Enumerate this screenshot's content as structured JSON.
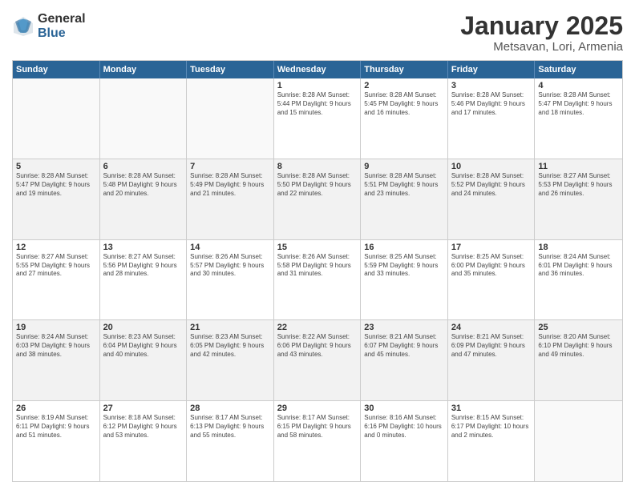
{
  "logo": {
    "general": "General",
    "blue": "Blue"
  },
  "title": {
    "month_year": "January 2025",
    "location": "Metsavan, Lori, Armenia"
  },
  "weekdays": [
    "Sunday",
    "Monday",
    "Tuesday",
    "Wednesday",
    "Thursday",
    "Friday",
    "Saturday"
  ],
  "rows": [
    [
      {
        "num": "",
        "info": ""
      },
      {
        "num": "",
        "info": ""
      },
      {
        "num": "",
        "info": ""
      },
      {
        "num": "1",
        "info": "Sunrise: 8:28 AM\nSunset: 5:44 PM\nDaylight: 9 hours\nand 15 minutes."
      },
      {
        "num": "2",
        "info": "Sunrise: 8:28 AM\nSunset: 5:45 PM\nDaylight: 9 hours\nand 16 minutes."
      },
      {
        "num": "3",
        "info": "Sunrise: 8:28 AM\nSunset: 5:46 PM\nDaylight: 9 hours\nand 17 minutes."
      },
      {
        "num": "4",
        "info": "Sunrise: 8:28 AM\nSunset: 5:47 PM\nDaylight: 9 hours\nand 18 minutes."
      }
    ],
    [
      {
        "num": "5",
        "info": "Sunrise: 8:28 AM\nSunset: 5:47 PM\nDaylight: 9 hours\nand 19 minutes."
      },
      {
        "num": "6",
        "info": "Sunrise: 8:28 AM\nSunset: 5:48 PM\nDaylight: 9 hours\nand 20 minutes."
      },
      {
        "num": "7",
        "info": "Sunrise: 8:28 AM\nSunset: 5:49 PM\nDaylight: 9 hours\nand 21 minutes."
      },
      {
        "num": "8",
        "info": "Sunrise: 8:28 AM\nSunset: 5:50 PM\nDaylight: 9 hours\nand 22 minutes."
      },
      {
        "num": "9",
        "info": "Sunrise: 8:28 AM\nSunset: 5:51 PM\nDaylight: 9 hours\nand 23 minutes."
      },
      {
        "num": "10",
        "info": "Sunrise: 8:28 AM\nSunset: 5:52 PM\nDaylight: 9 hours\nand 24 minutes."
      },
      {
        "num": "11",
        "info": "Sunrise: 8:27 AM\nSunset: 5:53 PM\nDaylight: 9 hours\nand 26 minutes."
      }
    ],
    [
      {
        "num": "12",
        "info": "Sunrise: 8:27 AM\nSunset: 5:55 PM\nDaylight: 9 hours\nand 27 minutes."
      },
      {
        "num": "13",
        "info": "Sunrise: 8:27 AM\nSunset: 5:56 PM\nDaylight: 9 hours\nand 28 minutes."
      },
      {
        "num": "14",
        "info": "Sunrise: 8:26 AM\nSunset: 5:57 PM\nDaylight: 9 hours\nand 30 minutes."
      },
      {
        "num": "15",
        "info": "Sunrise: 8:26 AM\nSunset: 5:58 PM\nDaylight: 9 hours\nand 31 minutes."
      },
      {
        "num": "16",
        "info": "Sunrise: 8:25 AM\nSunset: 5:59 PM\nDaylight: 9 hours\nand 33 minutes."
      },
      {
        "num": "17",
        "info": "Sunrise: 8:25 AM\nSunset: 6:00 PM\nDaylight: 9 hours\nand 35 minutes."
      },
      {
        "num": "18",
        "info": "Sunrise: 8:24 AM\nSunset: 6:01 PM\nDaylight: 9 hours\nand 36 minutes."
      }
    ],
    [
      {
        "num": "19",
        "info": "Sunrise: 8:24 AM\nSunset: 6:03 PM\nDaylight: 9 hours\nand 38 minutes."
      },
      {
        "num": "20",
        "info": "Sunrise: 8:23 AM\nSunset: 6:04 PM\nDaylight: 9 hours\nand 40 minutes."
      },
      {
        "num": "21",
        "info": "Sunrise: 8:23 AM\nSunset: 6:05 PM\nDaylight: 9 hours\nand 42 minutes."
      },
      {
        "num": "22",
        "info": "Sunrise: 8:22 AM\nSunset: 6:06 PM\nDaylight: 9 hours\nand 43 minutes."
      },
      {
        "num": "23",
        "info": "Sunrise: 8:21 AM\nSunset: 6:07 PM\nDaylight: 9 hours\nand 45 minutes."
      },
      {
        "num": "24",
        "info": "Sunrise: 8:21 AM\nSunset: 6:09 PM\nDaylight: 9 hours\nand 47 minutes."
      },
      {
        "num": "25",
        "info": "Sunrise: 8:20 AM\nSunset: 6:10 PM\nDaylight: 9 hours\nand 49 minutes."
      }
    ],
    [
      {
        "num": "26",
        "info": "Sunrise: 8:19 AM\nSunset: 6:11 PM\nDaylight: 9 hours\nand 51 minutes."
      },
      {
        "num": "27",
        "info": "Sunrise: 8:18 AM\nSunset: 6:12 PM\nDaylight: 9 hours\nand 53 minutes."
      },
      {
        "num": "28",
        "info": "Sunrise: 8:17 AM\nSunset: 6:13 PM\nDaylight: 9 hours\nand 55 minutes."
      },
      {
        "num": "29",
        "info": "Sunrise: 8:17 AM\nSunset: 6:15 PM\nDaylight: 9 hours\nand 58 minutes."
      },
      {
        "num": "30",
        "info": "Sunrise: 8:16 AM\nSunset: 6:16 PM\nDaylight: 10 hours\nand 0 minutes."
      },
      {
        "num": "31",
        "info": "Sunrise: 8:15 AM\nSunset: 6:17 PM\nDaylight: 10 hours\nand 2 minutes."
      },
      {
        "num": "",
        "info": ""
      }
    ]
  ]
}
